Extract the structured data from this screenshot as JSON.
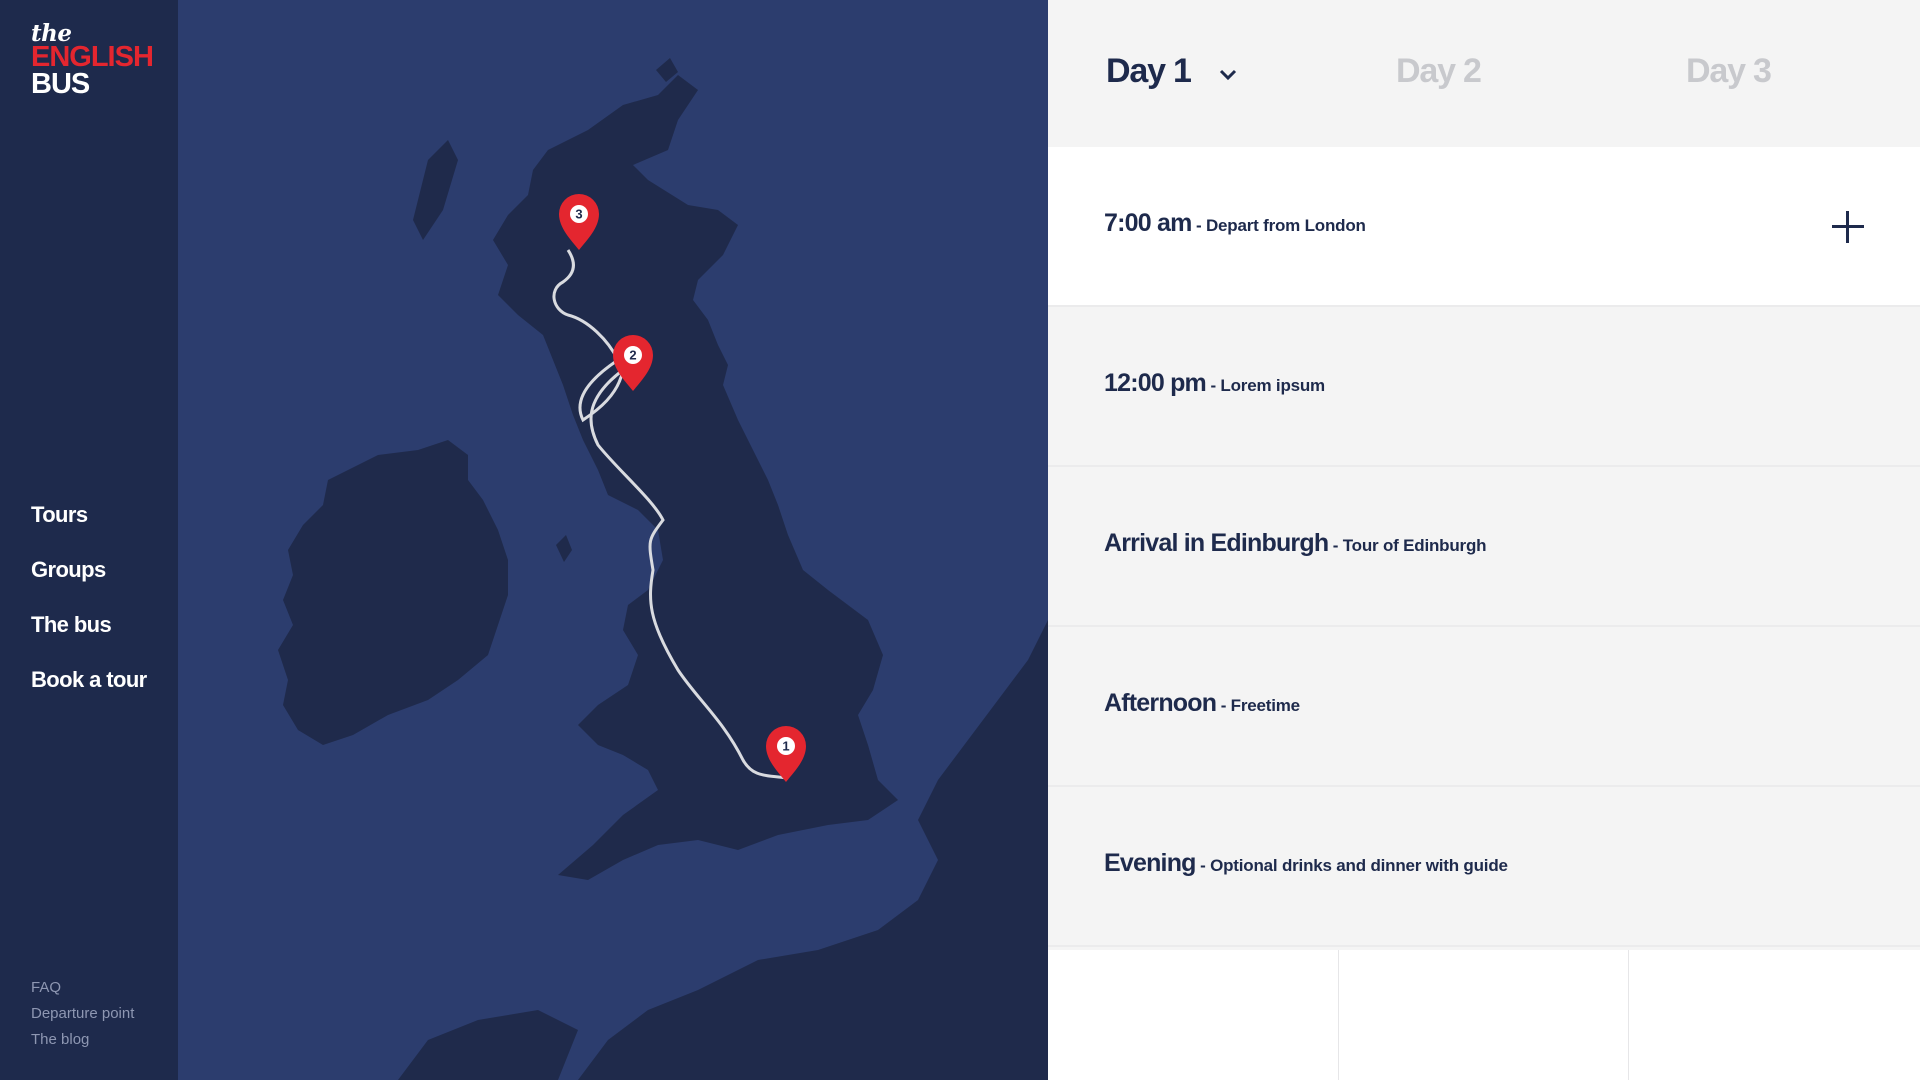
{
  "brand": {
    "the": "the",
    "english": "ENGLISH",
    "bus": "BUS"
  },
  "nav": [
    "Tours",
    "Groups",
    "The bus",
    "Book a tour"
  ],
  "footer_links": [
    "FAQ",
    "Departure point",
    "The blog"
  ],
  "map": {
    "markers": [
      {
        "number": "1"
      },
      {
        "number": "2"
      },
      {
        "number": "3"
      }
    ],
    "colors": {
      "sea": "#2c3d6e",
      "land": "#1f2a4b",
      "route": "#d9dbe0",
      "marker": "#e4262f"
    }
  },
  "tabs": [
    {
      "label": "Day 1",
      "active": true
    },
    {
      "label": "Day 2",
      "active": false
    },
    {
      "label": "Day 3",
      "active": false
    }
  ],
  "schedule": [
    {
      "time": "7:00 am",
      "desc": "- Depart from London"
    },
    {
      "time": "12:00 pm",
      "desc": "- Lorem ipsum"
    },
    {
      "time": "Arrival in Edinburgh",
      "desc": "- Tour of Edinburgh"
    },
    {
      "time": "Afternoon",
      "desc": "- Freetime"
    },
    {
      "time": "Evening",
      "desc": "- Optional drinks and dinner with guide"
    }
  ],
  "colors": {
    "navy": "#1e2a4c",
    "red": "#e4262f",
    "panel_bg": "#f4f4f4",
    "inactive_tab": "#c8c9cd"
  }
}
